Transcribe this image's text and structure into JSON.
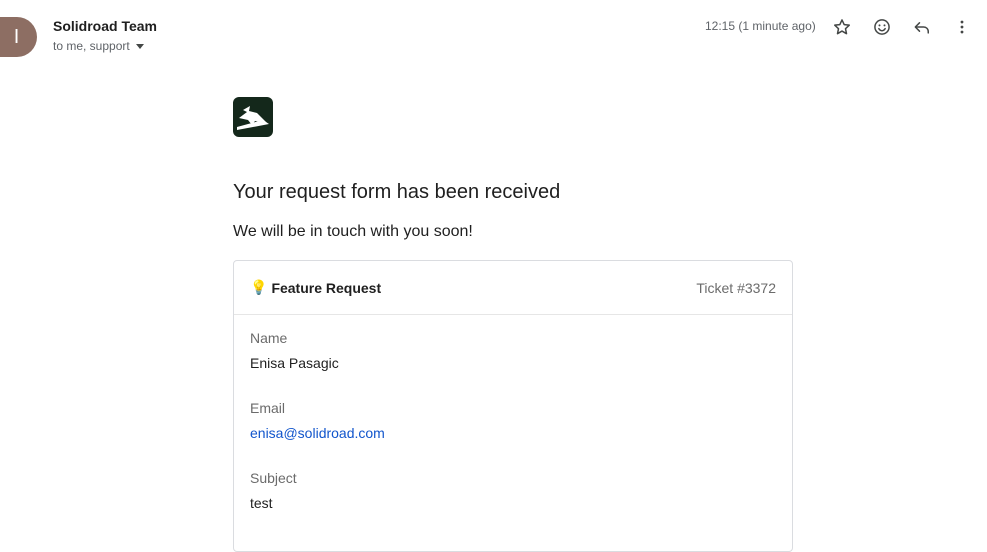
{
  "header": {
    "avatar_letter": "I",
    "sender": "Solidroad Team",
    "recipients": "to me, support",
    "time": "12:15 (1 minute ago)",
    "icons": [
      "star-icon",
      "emoji-icon",
      "reply-icon",
      "more-vert-icon"
    ]
  },
  "email": {
    "headline": "Your request form has been received",
    "subline": "We will be in touch with you soon!",
    "card": {
      "emoji": "💡",
      "title": "Feature Request",
      "ticket": "Ticket #3372",
      "fields": [
        {
          "label": "Name",
          "value": "Enisa Pasagic"
        },
        {
          "label": "Email",
          "value": "enisa@solidroad.com"
        },
        {
          "label": "Subject",
          "value": "test"
        }
      ]
    }
  },
  "colors": {
    "avatar": "#8d6e63",
    "logo_bg": "#14281b",
    "link": "#1155cc"
  }
}
